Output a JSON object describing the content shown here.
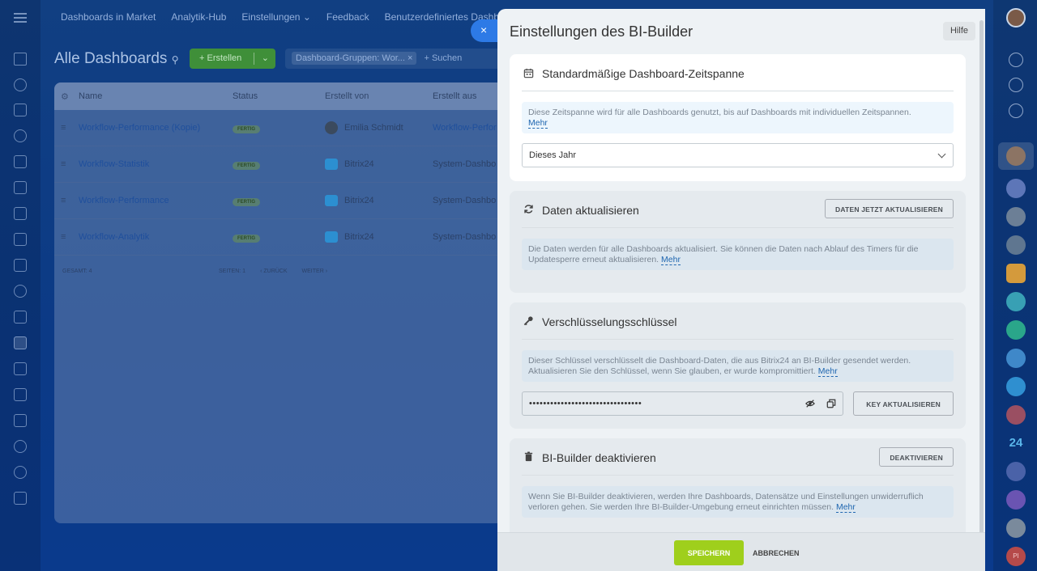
{
  "topnav": [
    "Dashboards in Market",
    "Analytik-Hub",
    "Einstellungen",
    "Feedback",
    "Benutzerdefiniertes Dashboa"
  ],
  "page": {
    "title": "Alle Dashboards",
    "create_label": "+ Erstellen",
    "filter_tag": "Dashboard-Gruppen: Wor...",
    "search_placeholder": "+ Suchen"
  },
  "grid": {
    "headers": [
      "Name",
      "Status",
      "Erstellt von",
      "Erstellt aus"
    ],
    "rows": [
      {
        "name": "Workflow-Performance (Kopie)",
        "status": "FERTIG",
        "creator": "Emilia Schmidt",
        "source": "Workflow-Perfor"
      },
      {
        "name": "Workflow-Statistik",
        "status": "FERTIG",
        "creator": "Bitrix24",
        "source": "System-Dashbo"
      },
      {
        "name": "Workflow-Performance",
        "status": "FERTIG",
        "creator": "Bitrix24",
        "source": "System-Dashbo"
      },
      {
        "name": "Workflow-Analytik",
        "status": "FERTIG",
        "creator": "Bitrix24",
        "source": "System-Dashbo"
      }
    ],
    "footer": {
      "total": "GESAMT: 4",
      "pages": "SEITEN: 1",
      "prev": "ZURÜCK",
      "next": "WEITER"
    }
  },
  "right_rail": {
    "badge_24": "24",
    "avatar_pi": "PI"
  },
  "slider": {
    "close_icon": "×",
    "title": "Einstellungen des BI-Builder",
    "help_label": "Hilfe",
    "period": {
      "title": "Standardmäßige Dashboard-Zeitspanne",
      "info": "Diese Zeitspanne wird für alle Dashboards genutzt, bis auf Dashboards mit individuellen Zeitspannen.",
      "more": "Mehr",
      "selected": "Dieses Jahr"
    },
    "refresh": {
      "title": "Daten aktualisieren",
      "button": "DATEN JETZT AKTUALISIEREN",
      "info": "Die Daten werden für alle Dashboards aktualisiert. Sie können die Daten nach Ablauf des Timers für die Updatesperre erneut aktualisieren.",
      "more": "Mehr"
    },
    "key": {
      "title": "Verschlüsselungsschlüssel",
      "info": "Dieser Schlüssel verschlüsselt die Dashboard-Daten, die aus Bitrix24 an BI-Builder gesendet werden. Aktualisieren Sie den Schlüssel, wenn Sie glauben, er wurde kompromittiert.",
      "more": "Mehr",
      "masked_value": "••••••••••••••••••••••••••••••••",
      "button": "KEY AKTUALISIEREN"
    },
    "deactivate": {
      "title": "BI-Builder deaktivieren",
      "button": "DEAKTIVIEREN",
      "info": "Wenn Sie BI-Builder deaktivieren, werden Ihre Dashboards, Datensätze und Einstellungen unwiderruflich verloren gehen. Sie werden Ihre BI-Builder-Umgebung erneut einrichten müssen.",
      "more": "Mehr"
    },
    "save_label": "SPEICHERN",
    "cancel_label": "ABBRECHEN"
  },
  "colors": {
    "accent": "#2067b0",
    "save": "#9fcf1c",
    "create": "#3f8f39"
  }
}
